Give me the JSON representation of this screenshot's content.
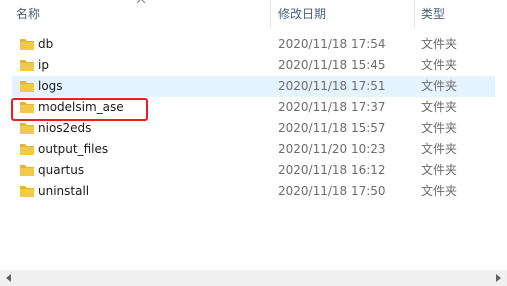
{
  "columns": {
    "name": "名称",
    "date": "修改日期",
    "type": "类型"
  },
  "rows": [
    {
      "name": "db",
      "date": "2020/11/18 17:54",
      "type": "文件夹"
    },
    {
      "name": "ip",
      "date": "2020/11/18 15:45",
      "type": "文件夹"
    },
    {
      "name": "logs",
      "date": "2020/11/18 17:51",
      "type": "文件夹"
    },
    {
      "name": "modelsim_ase",
      "date": "2020/11/18 17:37",
      "type": "文件夹"
    },
    {
      "name": "nios2eds",
      "date": "2020/11/18 15:57",
      "type": "文件夹"
    },
    {
      "name": "output_files",
      "date": "2020/11/20 10:23",
      "type": "文件夹"
    },
    {
      "name": "quartus",
      "date": "2020/11/18 16:12",
      "type": "文件夹"
    },
    {
      "name": "uninstall",
      "date": "2020/11/18 17:50",
      "type": "文件夹"
    }
  ],
  "colors": {
    "folder": "#f3c94b",
    "folder_back": "#e6b23a",
    "hover": "#e5f3ff",
    "highlight_box": "#e52020"
  }
}
